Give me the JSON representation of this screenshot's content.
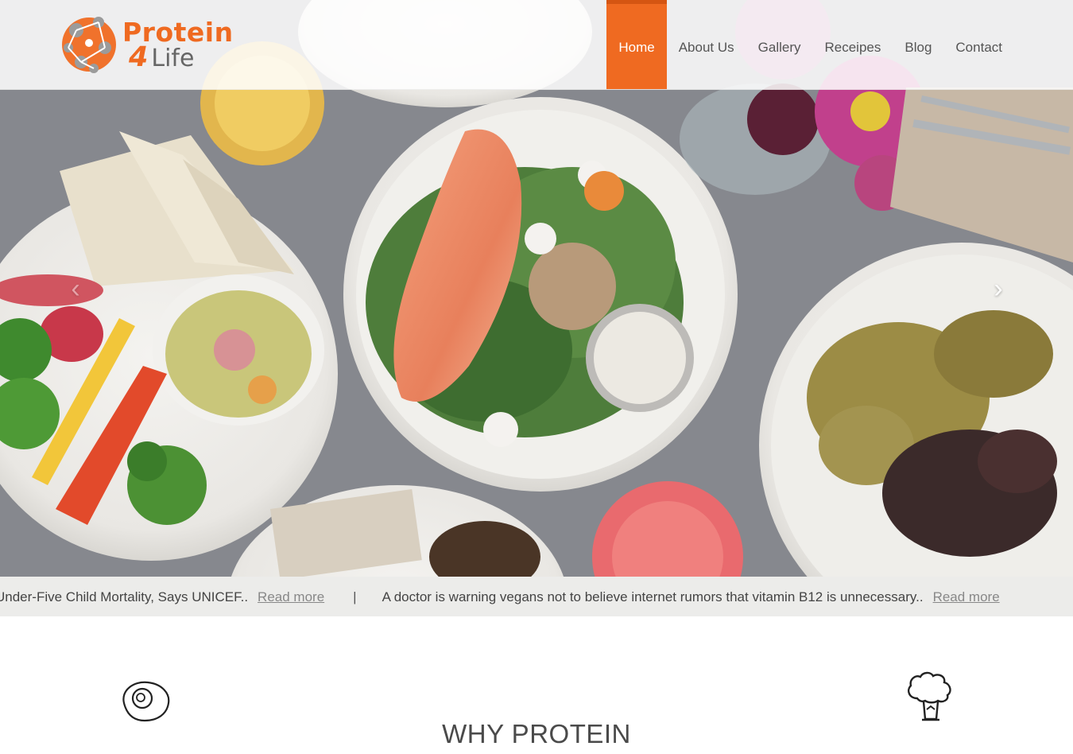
{
  "brand": {
    "word1": "Protein",
    "four": "4",
    "word2": "Life",
    "accent_color": "#ef6a21"
  },
  "nav": {
    "items": [
      {
        "label": "Home",
        "active": true
      },
      {
        "label": "About Us",
        "active": false
      },
      {
        "label": "Gallery",
        "active": false
      },
      {
        "label": "Receipes",
        "active": false
      },
      {
        "label": "Blog",
        "active": false
      },
      {
        "label": "Contact",
        "active": false
      }
    ]
  },
  "carousel": {
    "prev_icon": "chevron-left-icon",
    "next_icon": "chevron-right-icon",
    "prev_glyph": "‹",
    "next_glyph": "›"
  },
  "ticker": {
    "items": [
      {
        "text": "Under-Five Child Mortality, Says UNICEF..",
        "link": "Read more"
      },
      {
        "text": "A doctor is warning vegans not to believe internet rumors that vitamin B12 is unnecessary..",
        "link": "Read more"
      }
    ],
    "separator": "|"
  },
  "features": {
    "left_icon": "egg-icon",
    "right_icon": "broccoli-icon"
  },
  "section": {
    "title": "WHY PROTEIN"
  }
}
